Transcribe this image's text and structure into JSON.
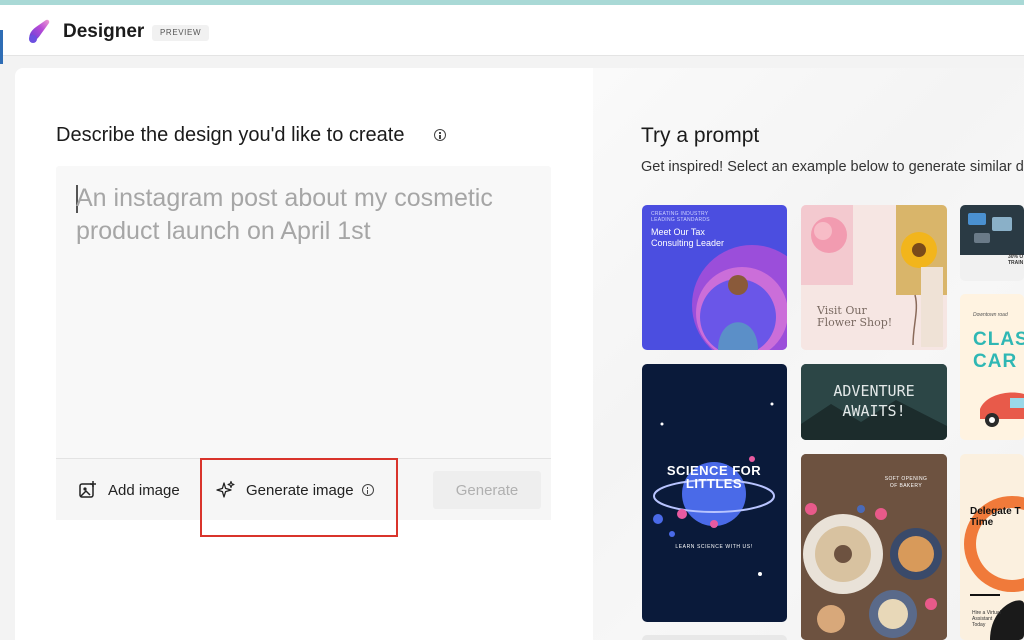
{
  "header": {
    "app_title": "Designer",
    "badge": "PREVIEW"
  },
  "describe": {
    "heading": "Describe the design you'd like to create",
    "placeholder": "An instagram post about my cosmetic product launch on April 1st",
    "add_image_label": "Add image",
    "generate_image_label": "Generate image",
    "generate_button_label": "Generate"
  },
  "try_prompt": {
    "heading": "Try a prompt",
    "subheading": "Get inspired! Select an example below to generate similar d"
  },
  "examples": {
    "tax": {
      "small": "CREATING INDUSTRY LEADING STANDARDS",
      "title_1": "Meet Our Tax",
      "title_2": "Consulting Leader"
    },
    "flower": {
      "line_1": "Visit Our",
      "line_2": "Flower Shop!"
    },
    "discount": {
      "line_1": "30% O",
      "line_2": "TRAIN"
    },
    "science": {
      "title_1": "SCIENCE FOR",
      "title_2": "LITTLES",
      "sub": "LEARN SCIENCE WITH US!"
    },
    "adventure": {
      "line_1": "ADVENTURE",
      "line_2": "AWAITS!"
    },
    "class": {
      "small": "Downtown road",
      "line_1": "CLAS",
      "line_2": "CAR"
    },
    "bakery": {
      "line_1": "SOFT OPENING",
      "line_2": "OF BAKERY"
    },
    "delegate": {
      "line_1": "Delegate T",
      "line_2": "Time",
      "small_1": "Hire a Virtual",
      "small_2": "Assistant",
      "small_3": "Today"
    }
  },
  "colors": {
    "accent_highlight": "#d9342b",
    "brand_top_strip": "#a9d9d6"
  },
  "icons": {
    "logo": "designer-logo-icon",
    "add_image": "add-image-icon",
    "generate_image": "sparkle-icon",
    "info": "info-icon"
  }
}
